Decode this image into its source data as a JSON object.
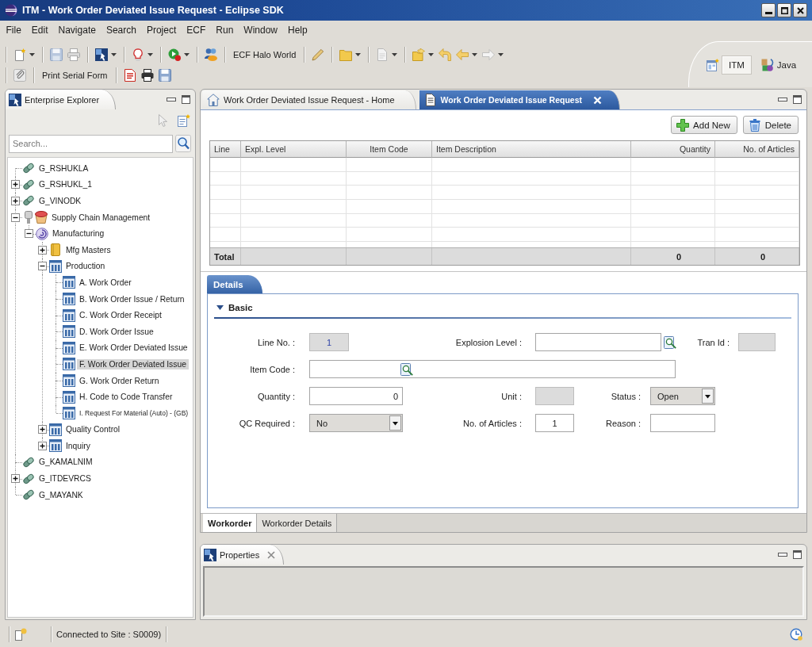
{
  "window": {
    "title": "ITM - Work Order Deviated Issue Request - Eclipse SDK"
  },
  "menu": [
    "File",
    "Edit",
    "Navigate",
    "Search",
    "Project",
    "ECF",
    "Run",
    "Window",
    "Help"
  ],
  "toolbar": {
    "halo_button": "ECF Halo World",
    "print_button": "Print Serial Form"
  },
  "perspectives": [
    {
      "label": "ITM",
      "kind": "plain",
      "selected": true
    },
    {
      "label": "Java",
      "kind": "with_icon",
      "selected": false
    }
  ],
  "explorer": {
    "title": "Enterprise Explorer",
    "search": {
      "placeholder": "Search..."
    },
    "tree": [
      {
        "label": "G_RSHUKLA",
        "kind": "connection",
        "expandable": false,
        "selected": false
      },
      {
        "label": "G_RSHUKL_1",
        "kind": "connection",
        "expandable": true,
        "expanded": false,
        "selected": false
      },
      {
        "label": "G_VINODK",
        "kind": "connection",
        "expandable": true,
        "expanded": false,
        "selected": false
      },
      {
        "label": "Supply Chain Management",
        "kind": "module",
        "expandable": true,
        "expanded": true,
        "selected": false,
        "children": [
          {
            "label": "Manufacturing",
            "kind": "process",
            "expandable": true,
            "expanded": true,
            "selected": false,
            "children": [
              {
                "label": "Mfg Masters",
                "kind": "folder",
                "expandable": true,
                "expanded": false,
                "selected": false
              },
              {
                "label": "Production",
                "kind": "menu",
                "expandable": true,
                "expanded": true,
                "selected": false,
                "children": [
                  {
                    "label": "A. Work Order",
                    "kind": "menu",
                    "expandable": false,
                    "selected": false
                  },
                  {
                    "label": "B. Work Order Issue / Return",
                    "kind": "menu",
                    "expandable": false,
                    "selected": false
                  },
                  {
                    "label": "C. Work Order Receipt",
                    "kind": "menu",
                    "expandable": false,
                    "selected": false
                  },
                  {
                    "label": "D. Work Order Issue",
                    "kind": "menu",
                    "expandable": false,
                    "selected": false
                  },
                  {
                    "label": "E. Work Order Deviated Issue",
                    "kind": "menu",
                    "expandable": false,
                    "selected": false
                  },
                  {
                    "label": "F. Work Order Deviated Issue",
                    "kind": "menu",
                    "expandable": false,
                    "selected": true
                  },
                  {
                    "label": "G. Work Order Return",
                    "kind": "menu",
                    "expandable": false,
                    "selected": false
                  },
                  {
                    "label": "H. Code to Code Transfer",
                    "kind": "menu",
                    "expandable": false,
                    "selected": false
                  },
                  {
                    "label": "I. Request For Material (Auto) - (GB)",
                    "kind": "menu",
                    "expandable": false,
                    "selected": false
                  }
                ]
              },
              {
                "label": "Quality Control",
                "kind": "menu",
                "expandable": true,
                "expanded": false,
                "selected": false
              },
              {
                "label": "Inquiry",
                "kind": "menu",
                "expandable": true,
                "expanded": false,
                "selected": false
              }
            ]
          }
        ]
      },
      {
        "label": "G_KAMALNIM",
        "kind": "connection",
        "expandable": false,
        "selected": false
      },
      {
        "label": "G_ITDEVRCS",
        "kind": "connection",
        "expandable": true,
        "expanded": false,
        "selected": false
      },
      {
        "label": "G_MAYANK",
        "kind": "connection",
        "expandable": false,
        "selected": false
      }
    ]
  },
  "editor": {
    "tabs": [
      {
        "label": "Work Order Deviated Issue Request - Home",
        "kind": "home",
        "selected": false
      },
      {
        "label": "Work Order Deviated Issue Request",
        "kind": "form",
        "selected": true
      }
    ],
    "buttons": [
      {
        "label": "Add New",
        "kind": "add"
      },
      {
        "label": "Delete",
        "kind": "delete"
      }
    ],
    "table": {
      "columns": [
        "Line",
        "Expl. Level",
        "Item Code",
        "Item Description",
        "Quantity",
        "No. of Articles"
      ],
      "total_row": {
        "label": "Total",
        "quantity": "0",
        "no_of_articles": "0"
      }
    },
    "details": {
      "tab": "Details",
      "section": {
        "title": "Basic",
        "expanded": true
      },
      "rows": [
        {
          "fields": [
            {
              "label": "Line No. :",
              "kind": "text",
              "readonly": true,
              "value": "1"
            },
            {
              "label": "Explosion Level :",
              "kind": "lookup",
              "readonly": false
            },
            {
              "label": "Tran Id :",
              "kind": "text",
              "readonly": true
            }
          ]
        },
        {
          "fields": [
            {
              "label": "Item Code :",
              "kind": "lookup",
              "readonly": false
            }
          ]
        },
        {
          "fields": [
            {
              "label": "Quantity :",
              "kind": "text",
              "readonly": false,
              "value": "0"
            },
            {
              "label": "Unit :",
              "kind": "text",
              "readonly": true
            },
            {
              "label": "Status :",
              "kind": "select",
              "readonly": false,
              "value": "Open"
            }
          ]
        },
        {
          "fields": [
            {
              "label": "QC Required :",
              "kind": "select",
              "readonly": false,
              "value": "No"
            },
            {
              "label": "No. of Articles :",
              "kind": "text",
              "readonly": false,
              "value": "1"
            },
            {
              "label": "Reason :",
              "kind": "text",
              "readonly": false
            }
          ]
        }
      ]
    },
    "bottom_tabs": [
      {
        "label": "Workorder",
        "selected": true
      },
      {
        "label": "Workorder Details",
        "selected": false
      }
    ]
  },
  "properties": {
    "title": "Properties"
  },
  "status_bar": {
    "text": "Connected to Site : S0009)"
  }
}
